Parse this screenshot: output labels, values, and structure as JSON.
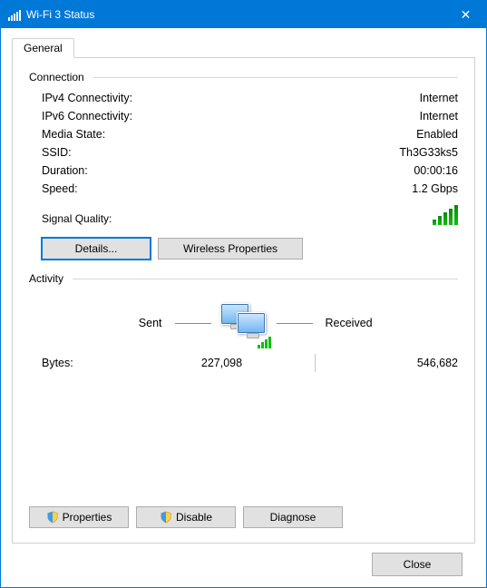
{
  "window": {
    "title": "Wi-Fi 3 Status"
  },
  "tab": {
    "general": "General"
  },
  "groups": {
    "connection": "Connection",
    "activity": "Activity"
  },
  "conn": {
    "ipv4_k": "IPv4 Connectivity:",
    "ipv4_v": "Internet",
    "ipv6_k": "IPv6 Connectivity:",
    "ipv6_v": "Internet",
    "media_k": "Media State:",
    "media_v": "Enabled",
    "ssid_k": "SSID:",
    "ssid_v": "Th3G33ks5",
    "dur_k": "Duration:",
    "dur_v": "00:00:16",
    "speed_k": "Speed:",
    "speed_v": "1.2 Gbps",
    "signal_k": "Signal Quality:"
  },
  "buttons": {
    "details": "Details...",
    "wireless_props": "Wireless Properties",
    "properties": "Properties",
    "disable": "Disable",
    "diagnose": "Diagnose",
    "close": "Close"
  },
  "activity": {
    "sent_label": "Sent",
    "received_label": "Received",
    "bytes_label": "Bytes:",
    "bytes_sent": "227,098",
    "bytes_received": "546,682"
  }
}
